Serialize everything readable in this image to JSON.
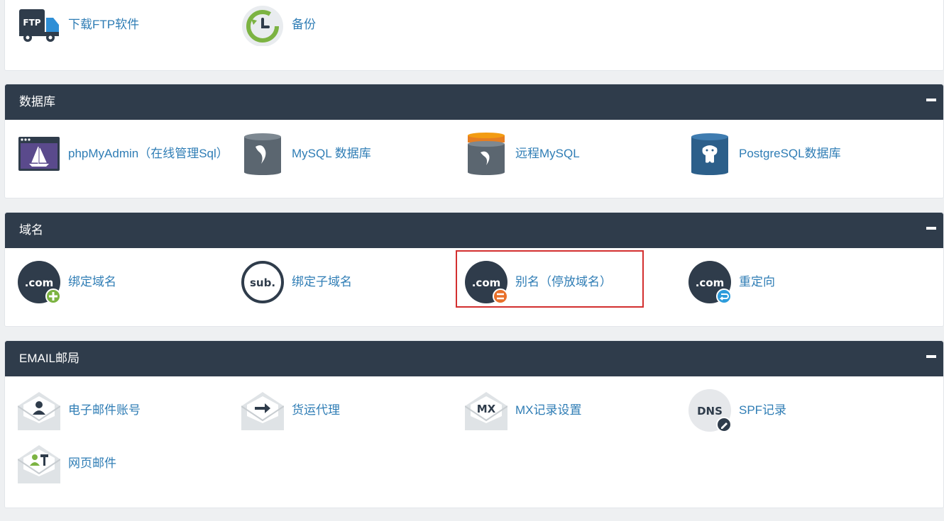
{
  "files_section": {
    "items": [
      {
        "label": "下载FTP软件",
        "icon": "ftp-truck-icon"
      },
      {
        "label": "备份",
        "icon": "backup-clock-icon"
      }
    ]
  },
  "database_section": {
    "title": "数据库",
    "items": [
      {
        "label": "phpMyAdmin（在线管理Sql）",
        "icon": "phpmyadmin-icon"
      },
      {
        "label": "MySQL 数据库",
        "icon": "mysql-database-icon"
      },
      {
        "label": "远程MySQL",
        "icon": "remote-mysql-icon"
      },
      {
        "label": "PostgreSQL数据库",
        "icon": "postgresql-icon"
      }
    ]
  },
  "domain_section": {
    "title": "域名",
    "items": [
      {
        "label": "绑定域名",
        "icon": "addon-domain-icon",
        "badge_text": ".com"
      },
      {
        "label": "绑定子域名",
        "icon": "subdomain-icon",
        "badge_text": "sub."
      },
      {
        "label": "别名（停放域名）",
        "icon": "parked-domain-icon",
        "badge_text": ".com"
      },
      {
        "label": "重定向",
        "icon": "redirect-icon",
        "badge_text": ".com"
      }
    ]
  },
  "email_section": {
    "title": "EMAIL邮局",
    "items": [
      {
        "label": "电子邮件账号",
        "icon": "email-account-icon"
      },
      {
        "label": "货运代理",
        "icon": "forwarder-icon"
      },
      {
        "label": "MX记录设置",
        "icon": "mx-record-icon",
        "badge_text": "MX"
      },
      {
        "label": "SPF记录",
        "icon": "spf-dns-icon",
        "badge_text": "DNS"
      },
      {
        "label": "网页邮件",
        "icon": "webmail-icon"
      }
    ]
  },
  "colors": {
    "header_bg": "#2f3c4b",
    "link": "#2f7db5",
    "highlight_border": "#d32f2f"
  }
}
